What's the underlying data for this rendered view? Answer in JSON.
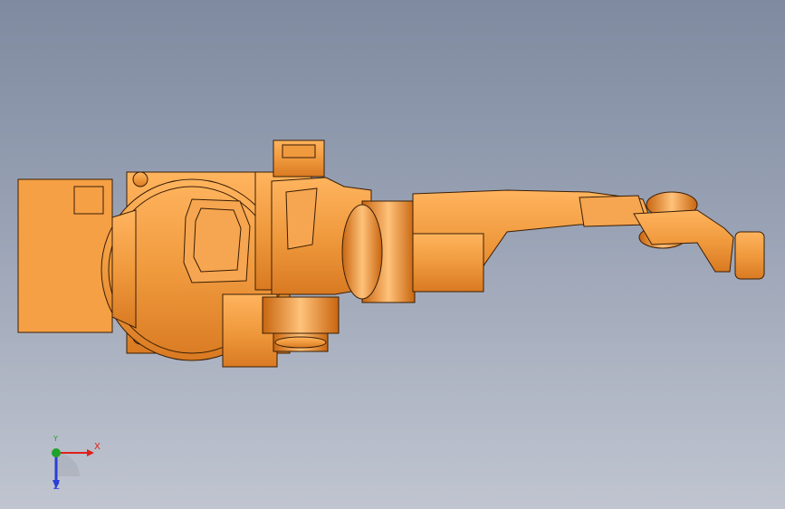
{
  "viewport": {
    "background_top": "#7f8aa0",
    "background_bottom": "#c0c5d0"
  },
  "model": {
    "part_color": "#f5a14a",
    "edge_color": "#3a1e05"
  },
  "triad": {
    "x_label": "X",
    "y_label": "Y",
    "z_label": "Z",
    "x_color": "#e0201c",
    "y_color": "#1fa32a",
    "z_color": "#2b3fd6"
  }
}
